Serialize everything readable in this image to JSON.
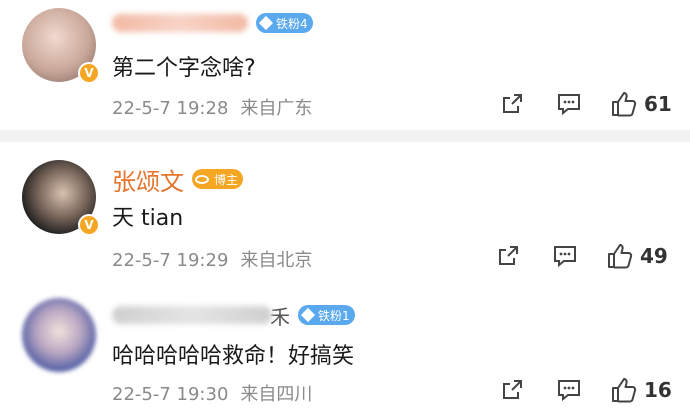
{
  "comments": [
    {
      "username": "",
      "username_blurred": true,
      "badge": {
        "type": "fan",
        "label": "铁粉4"
      },
      "verified_badge": "V",
      "content": "第二个字念啥?",
      "time": "22-5-7 19:28",
      "location": "来自广东",
      "likes": "61",
      "icons": [
        "share-icon",
        "comment-icon",
        "like-icon"
      ]
    },
    {
      "username": "张颂文",
      "username_blurred": false,
      "badge": {
        "type": "host",
        "label": "博主"
      },
      "verified_badge": "V",
      "content": "天 tian",
      "time": "22-5-7 19:29",
      "location": "来自北京",
      "likes": "49",
      "icons": [
        "share-icon",
        "comment-icon",
        "like-icon"
      ]
    },
    {
      "username": "",
      "username_suffix": "禾",
      "username_blurred": true,
      "badge": {
        "type": "fan",
        "label": "铁粉1"
      },
      "verified_badge": "",
      "content": "哈哈哈哈哈救命！好搞笑",
      "time": "22-5-7 19:30",
      "location": "来自四川",
      "likes": "16",
      "icons": [
        "share-icon",
        "comment-icon",
        "like-icon"
      ]
    }
  ],
  "colors": {
    "username": "#e6742c",
    "fan_badge": "#5aa9ef",
    "host_badge": "#f5a623",
    "meta_text": "#8a8a8a",
    "separator": "#f2f2f2"
  }
}
